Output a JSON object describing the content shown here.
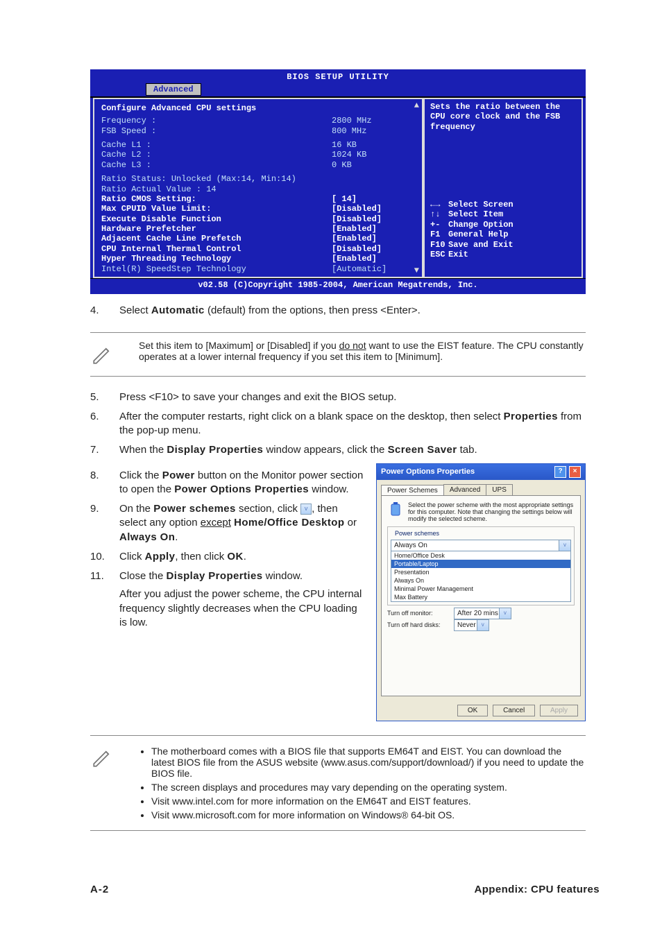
{
  "bios": {
    "title": "BIOS SETUP UTILITY",
    "tab_active": "Advanced",
    "panel_title": "Configure Advanced CPU settings",
    "info_lines": [
      {
        "label": "Frequency   :",
        "value": " 2800 MHz"
      },
      {
        "label": "FSB Speed   :",
        "value": " 800 MHz"
      }
    ],
    "cache_lines": [
      {
        "label": "Cache L1    :",
        "value": " 16 KB"
      },
      {
        "label": "Cache L2    :",
        "value": " 1024 KB"
      },
      {
        "label": "Cache L3    :",
        "value": " 0 KB"
      }
    ],
    "ratio_status": "Ratio Status: Unlocked (Max:14, Min:14)",
    "ratio_actual": "Ratio Actual Value : 14",
    "settings": [
      {
        "label": "  Ratio CMOS Setting:",
        "value": "[  14]"
      },
      {
        "label": "Max CPUID Value Limit:",
        "value": "[Disabled]"
      },
      {
        "label": "Execute Disable Function",
        "value": "[Disabled]"
      },
      {
        "label": "Hardware Prefetcher",
        "value": "[Enabled]"
      },
      {
        "label": "Adjacent Cache Line Prefetch",
        "value": "[Enabled]"
      },
      {
        "label": "CPU Internal Thermal Control",
        "value": "[Disabled]"
      },
      {
        "label": "Hyper Threading Technology",
        "value": "[Enabled]"
      },
      {
        "label": "Intel(R) SpeedStep Technology",
        "value": "[Automatic]"
      }
    ],
    "help_text": "Sets the ratio between the CPU core clock and the FSB frequency",
    "hints": [
      {
        "key": "←→",
        "desc": "Select Screen"
      },
      {
        "key": "↑↓",
        "desc": "Select Item"
      },
      {
        "key": "+-",
        "desc": "Change Option"
      },
      {
        "key": "F1",
        "desc": "General Help"
      },
      {
        "key": "F10",
        "desc": "Save and Exit"
      },
      {
        "key": "ESC",
        "desc": "Exit"
      }
    ],
    "copyright": "v02.58 (C)Copyright 1985-2004, American Megatrends, Inc."
  },
  "steps": {
    "s4": {
      "num": "4.",
      "pre": "Select ",
      "bold": "Automatic",
      "post": " (default) from the options, then press <Enter>."
    },
    "note1": {
      "pre": "Set this item to [Maximum] or [Disabled] if you ",
      "u": "do not",
      "post": " want to use the EIST feature. The CPU constantly operates at a lower internal frequency if you set this item to [Minimum]."
    },
    "s5": {
      "num": "5.",
      "txt": "Press <F10> to save your changes and exit the BIOS setup."
    },
    "s6": {
      "num": "6.",
      "pre": "After the computer restarts, right click on a blank space on the desktop, then select ",
      "bold": "Properties",
      "post": " from the pop-up menu."
    },
    "s7": {
      "num": "7.",
      "pre": "When the ",
      "b1": "Display Properties",
      "mid": " window appears, click the ",
      "b2": "Screen Saver",
      "post": " tab."
    },
    "s8": {
      "num": "8.",
      "pre": "Click the ",
      "b1": "Power",
      "mid": " button on the Monitor power section to open the ",
      "b2": "Power Options Properties",
      "post": " window."
    },
    "s9": {
      "num": "9.",
      "pre": "On the ",
      "b1": "Power schemes",
      "mid": " section, click ",
      "post1": ", then select any option ",
      "u": "except",
      "post2": " ",
      "b2": "Home/Office Desktop",
      "mid2": " or ",
      "b3": "Always On",
      "end": "."
    },
    "s10": {
      "num": "10.",
      "pre": "Click ",
      "b1": "Apply",
      "mid": ", then click ",
      "b2": "OK",
      "end": "."
    },
    "s11": {
      "num": "11.",
      "pre": "Close the ",
      "b1": "Display Properties",
      "post": " window.",
      "tail": "After you adjust the power scheme, the CPU internal frequency slightly decreases when the CPU loading is low."
    }
  },
  "note2": [
    "The motherboard comes with a BIOS file that supports EM64T and EIST. You can download the latest BIOS file from the ASUS website (www.asus.com/support/download/) if you need to update the BIOS file.",
    "The screen displays and procedures may vary depending on the operating system.",
    "Visit www.intel.com for more information on the EM64T and EIST features.",
    "Visit www.microsoft.com for more information on Windows® 64-bit OS."
  ],
  "dialog": {
    "title": "Power Options Properties",
    "tabs": [
      "Power Schemes",
      "Advanced",
      "UPS"
    ],
    "info_text": "Select the power scheme with the most appropriate settings for this computer. Note that changing the settings below will modify the selected scheme.",
    "legend": "Power schemes",
    "selected": "Always On",
    "options": [
      "Home/Office Desk",
      "Portable/Laptop",
      "Presentation",
      "Always On",
      "Minimal Power Management",
      "Max Battery"
    ],
    "highlight_index": 1,
    "monitor_label": "Turn off monitor:",
    "monitor_value": "After 20 mins",
    "hdd_label": "Turn off hard disks:",
    "hdd_value": "Never",
    "buttons": {
      "ok": "OK",
      "cancel": "Cancel",
      "apply": "Apply"
    }
  },
  "footer": {
    "page": "A-2",
    "appendix": "Appendix: CPU features"
  }
}
